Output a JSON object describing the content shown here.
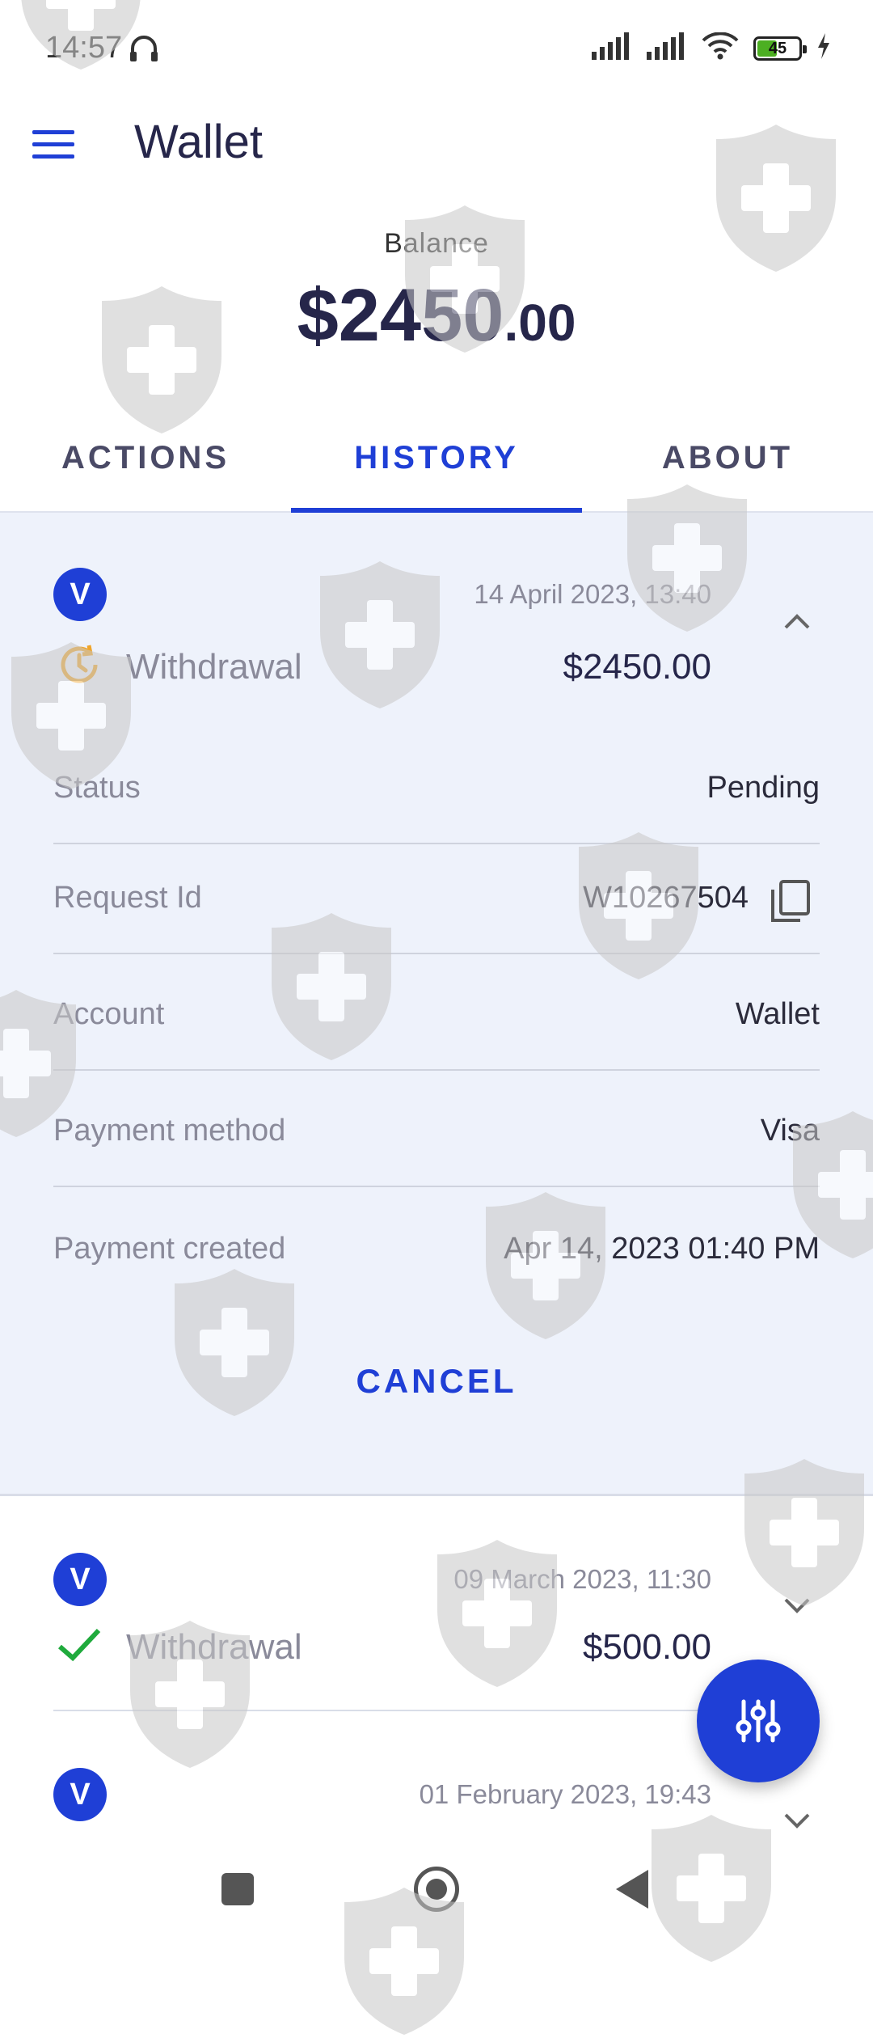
{
  "status_bar": {
    "time": "14:57",
    "battery": "45"
  },
  "app_bar": {
    "title": "Wallet"
  },
  "balance": {
    "label": "Balance",
    "amount_int": "$2450",
    "amount_dec": ".00"
  },
  "tabs": [
    {
      "label": "ACTIONS",
      "active": false
    },
    {
      "label": "HISTORY",
      "active": true
    },
    {
      "label": "ABOUT",
      "active": false
    }
  ],
  "transactions": [
    {
      "badge": "V",
      "date": "14 April 2023, 13:40",
      "type": "Withdrawal",
      "amount": "$2450.00",
      "status_icon": "pending-clock-icon",
      "expanded": true,
      "details": [
        {
          "key": "Status",
          "value": "Pending"
        },
        {
          "key": "Request Id",
          "value": "W10267504"
        },
        {
          "key": "Account",
          "value": "Wallet"
        },
        {
          "key": "Payment method",
          "value": "Visa"
        },
        {
          "key": "Payment created",
          "value": "Apr 14, 2023 01:40 PM"
        }
      ],
      "action_label": "CANCEL"
    },
    {
      "badge": "V",
      "date": "09 March 2023, 11:30",
      "type": "Withdrawal",
      "amount": "$500.00",
      "status_icon": "checkmark-icon",
      "expanded": false
    },
    {
      "badge": "V",
      "date": "01 February 2023, 19:43",
      "expanded": false
    }
  ],
  "colors": {
    "accent": "#1f3fd6",
    "pending": "#f0a52a",
    "success": "#1faa3c",
    "card_bg": "#eef2fb"
  }
}
